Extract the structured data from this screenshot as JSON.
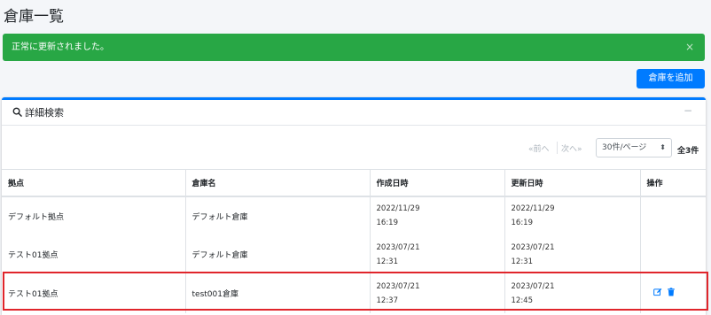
{
  "page": {
    "title": "倉庫一覧"
  },
  "alert": {
    "message": "正常に更新されました。",
    "close_glyph": "×"
  },
  "toolbar": {
    "add_label": "倉庫を追加"
  },
  "search_card": {
    "title": "詳細検索",
    "collapse_glyph": "−"
  },
  "pagination": {
    "prev_label": "«前へ",
    "next_label": "次へ»",
    "per_page_value": "30件/ページ",
    "total_label": "全3件"
  },
  "table": {
    "headers": [
      "拠点",
      "倉庫名",
      "作成日時",
      "更新日時",
      "操作"
    ],
    "rows": [
      {
        "base": "デフォルト拠点",
        "warehouse": "デフォルト倉庫",
        "created_date": "2022/11/29",
        "created_time": "16:19",
        "updated_date": "2022/11/29",
        "updated_time": "16:19",
        "actions": false
      },
      {
        "base": "テスト01拠点",
        "warehouse": "デフォルト倉庫",
        "created_date": "2023/07/21",
        "created_time": "12:31",
        "updated_date": "2023/07/21",
        "updated_time": "12:31",
        "actions": false
      },
      {
        "base": "テスト01拠点",
        "warehouse": "test001倉庫",
        "created_date": "2023/07/21",
        "created_time": "12:37",
        "updated_date": "2023/07/21",
        "updated_time": "12:45",
        "actions": true
      }
    ]
  },
  "colors": {
    "success": "#28a745",
    "primary": "#007bff",
    "highlight": "#e0252b"
  },
  "icons": {
    "search": "search-icon",
    "edit": "edit-icon",
    "delete": "trash-icon"
  }
}
